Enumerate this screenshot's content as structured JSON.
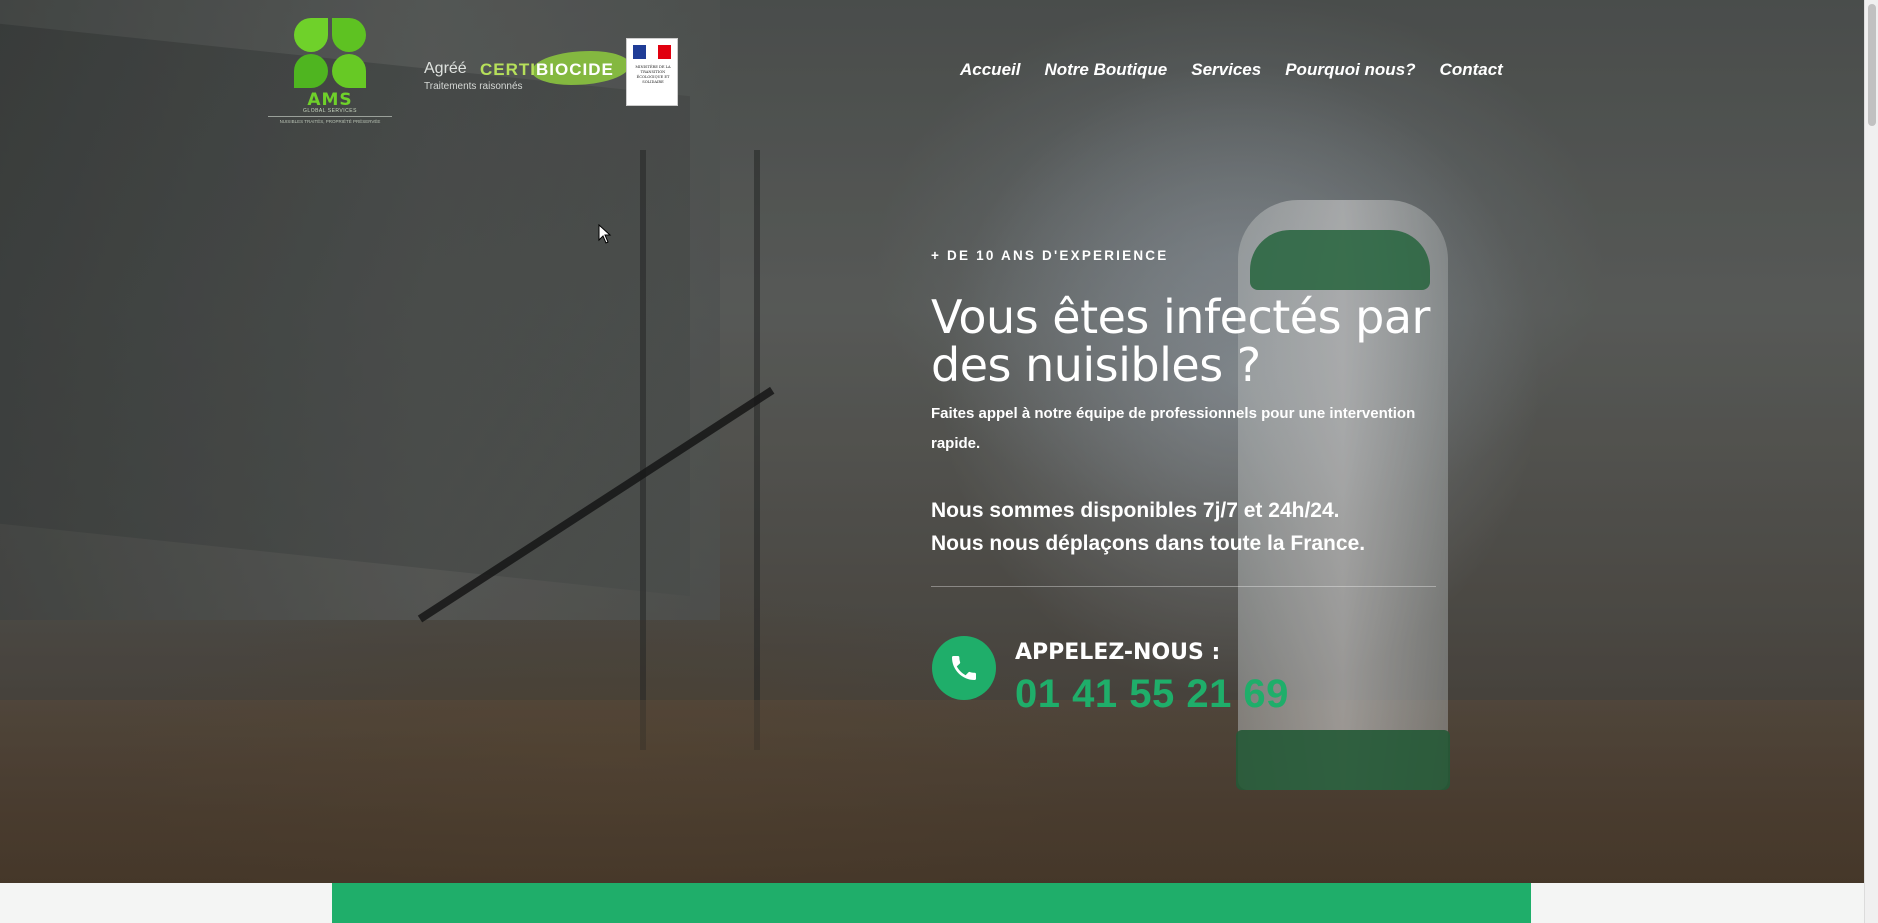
{
  "logo": {
    "brand": "AMS",
    "sub": "GLOBAL SERVICES",
    "tagline": "NUISIBLES TRAITÉS, PROPRIÉTÉ PRÉSERVÉE"
  },
  "certification": {
    "agree": "Agréé",
    "certi": "CERTI",
    "biocide": "BIOCIDE",
    "treatments": "Traitements raisonnés",
    "ministry": "MINISTÈRE DE LA TRANSITION ÉCOLOGIQUE ET SOLIDAIRE"
  },
  "nav": {
    "items": [
      "Accueil",
      "Notre Boutique",
      "Services",
      "Pourquoi nous?",
      "Contact"
    ]
  },
  "hero": {
    "eyebrow": "+ DE 10 ANS D'EXPERIENCE",
    "headline": "Vous êtes infectés par des nuisibles ?",
    "intro": "Faites appel à notre équipe de professionnels pour une intervention rapide.",
    "availability_1": "Nous sommes disponibles 7j/7 et 24h/24.",
    "availability_2": "Nous nous déplaçons dans toute la France."
  },
  "call": {
    "label": "APPELEZ-NOUS :",
    "phone": "01 41 55 21 69",
    "icon": "phone-icon"
  },
  "colors": {
    "accent": "#1fae6a",
    "logo_green": "#6fd12a",
    "certi_green": "#b6e05a"
  }
}
